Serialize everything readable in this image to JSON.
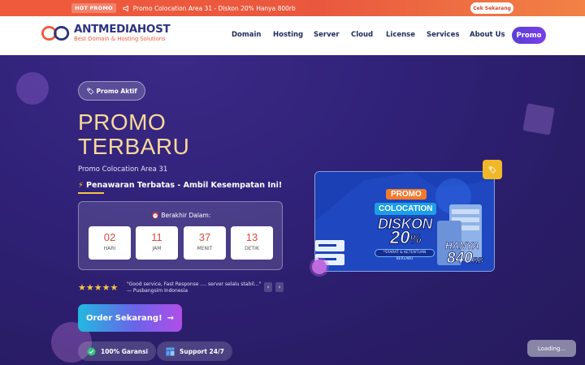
{
  "topbar": {
    "hot_label": "HOT PROMO",
    "icon": "megaphone-icon",
    "message": "Promo Colocation Area 31 - Diskon 20% Hanya 800rb",
    "cta_label": "Cek Sekarang"
  },
  "brand": {
    "name": "ANTMEDIAHOST",
    "tagline": "Best Domain & Hosting Solutions",
    "colors": {
      "navy": "#2b3480",
      "orange": "#f15b3a"
    }
  },
  "nav": {
    "items": [
      "Domain",
      "Hosting",
      "Server",
      "Cloud",
      "License",
      "Services",
      "About Us"
    ],
    "promo_label": "Promo"
  },
  "hero": {
    "badge": "🏷 Promo Aktif",
    "title_line1": "PROMO",
    "title_line2": "TERBARU",
    "subtitle": "Promo Colocation Area 31",
    "limited_bolt": "⚡",
    "limited_text": "Penawaran Terbatas - Ambil Kesempatan Ini!",
    "countdown": {
      "label": "⏰ Berakhir Dalam:",
      "units": [
        {
          "value": "02",
          "unit": "HARI"
        },
        {
          "value": "11",
          "unit": "JAM"
        },
        {
          "value": "37",
          "unit": "MENIT"
        },
        {
          "value": "13",
          "unit": "DETIK"
        }
      ]
    },
    "rating": {
      "stars": 5,
      "stars_text": "★★★★★"
    },
    "review": {
      "quote": "\"Good service, Fast Response .... server selalu stabil...\"",
      "author": "— Pusbangsim Indonesia"
    },
    "review_prev": "‹",
    "review_next": "›",
    "order_label": "Order Sekarang!",
    "order_arrow": "→",
    "pills": [
      {
        "label": "100% Garansi",
        "icon": "check-circle-icon"
      },
      {
        "label": "Support 24/7",
        "icon": "support-grid-icon"
      }
    ]
  },
  "banner": {
    "corner_badge": "🏷",
    "promo": "PROMO",
    "colocation": "COLOCATION",
    "diskon": "DISKON",
    "percent": "20",
    "percent_symbol": "%",
    "terms": "*SYARAT & KETENTUAN BERLAKU",
    "hanya": "HANYA",
    "price": "840",
    "price_unit": "RB"
  },
  "loading_text": "Loading..."
}
